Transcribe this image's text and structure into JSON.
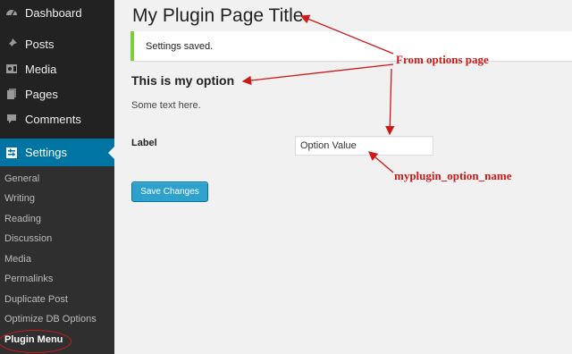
{
  "sidebar": {
    "items": [
      {
        "label": "Dashboard",
        "icon": "dashboard-icon"
      },
      {
        "label": "Posts",
        "icon": "pin-icon"
      },
      {
        "label": "Media",
        "icon": "media-icon"
      },
      {
        "label": "Pages",
        "icon": "pages-icon"
      },
      {
        "label": "Comments",
        "icon": "comment-icon"
      },
      {
        "label": "Settings",
        "icon": "settings-icon",
        "active": true
      }
    ],
    "submenu": [
      "General",
      "Writing",
      "Reading",
      "Discussion",
      "Media",
      "Permalinks",
      "Duplicate Post",
      "Optimize DB Options",
      "Plugin Menu"
    ],
    "current_submenu": "Plugin Menu"
  },
  "main": {
    "title": "My Plugin Page Title",
    "notice": "Settings saved.",
    "section_title": "This is my option",
    "section_desc": "Some text here.",
    "field": {
      "label": "Label",
      "value": "Option Value"
    },
    "save_button": "Save Changes"
  },
  "annotations": {
    "from_options_page": "From options page",
    "option_name": "myplugin_option_name",
    "color": "#d01818"
  },
  "colors": {
    "sidebar_bg": "#222222",
    "active_blue": "#0074a2",
    "notice_green": "#7ad03a",
    "button_blue": "#2ea2cc"
  }
}
